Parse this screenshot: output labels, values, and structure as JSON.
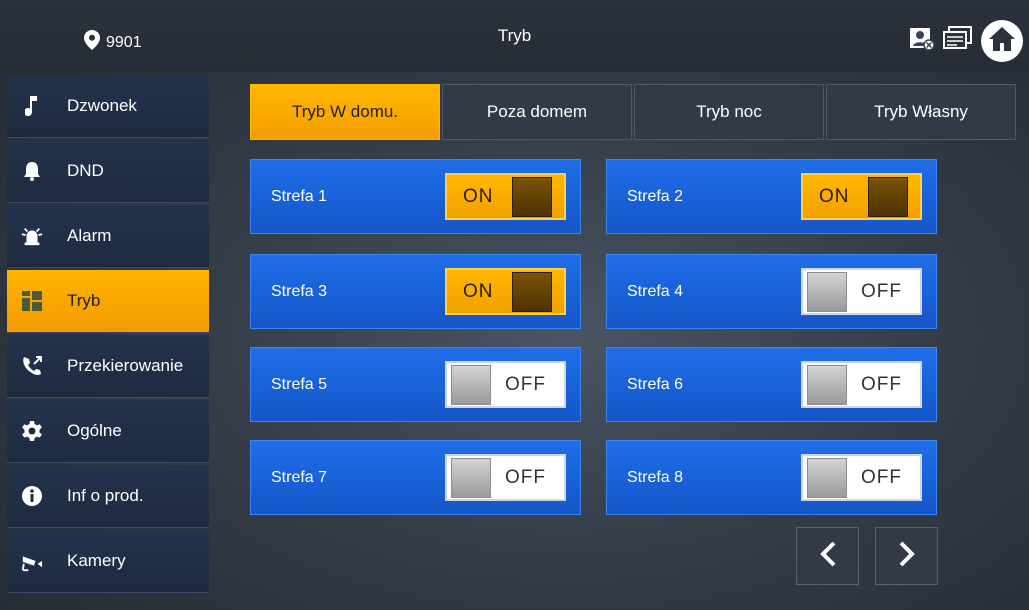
{
  "header": {
    "room_number": "9901",
    "title": "Tryb"
  },
  "icons": {
    "location": "location-pin-icon",
    "contact_card": "contact-card-icon",
    "message": "message-icon",
    "home": "home-icon"
  },
  "sidebar": {
    "items": [
      {
        "label": "Dzwonek",
        "icon": "music-note-icon"
      },
      {
        "label": "DND",
        "icon": "bell-icon"
      },
      {
        "label": "Alarm",
        "icon": "alarm-siren-icon"
      },
      {
        "label": "Tryb",
        "icon": "mode-grid-icon"
      },
      {
        "label": "Przekierowanie",
        "icon": "call-forward-icon"
      },
      {
        "label": "Ogólne",
        "icon": "gear-icon"
      },
      {
        "label": "Inf o prod.",
        "icon": "info-icon"
      },
      {
        "label": "Kamery",
        "icon": "camera-icon"
      }
    ],
    "active_index": 3
  },
  "tabs": [
    {
      "label": "Tryb W domu.",
      "active": true
    },
    {
      "label": "Poza domem",
      "active": false
    },
    {
      "label": "Tryb noc",
      "active": false
    },
    {
      "label": "Tryb Własny",
      "active": false
    }
  ],
  "zones": [
    {
      "label": "Strefa 1",
      "state": "ON"
    },
    {
      "label": "Strefa 2",
      "state": "ON"
    },
    {
      "label": "Strefa 3",
      "state": "ON"
    },
    {
      "label": "Strefa 4",
      "state": "OFF"
    },
    {
      "label": "Strefa 5",
      "state": "OFF"
    },
    {
      "label": "Strefa 6",
      "state": "OFF"
    },
    {
      "label": "Strefa 7",
      "state": "OFF"
    },
    {
      "label": "Strefa 8",
      "state": "OFF"
    }
  ],
  "colors": {
    "accent": "#FFB400",
    "zone_blue": "#1A63DC",
    "background": "#2E3540"
  }
}
